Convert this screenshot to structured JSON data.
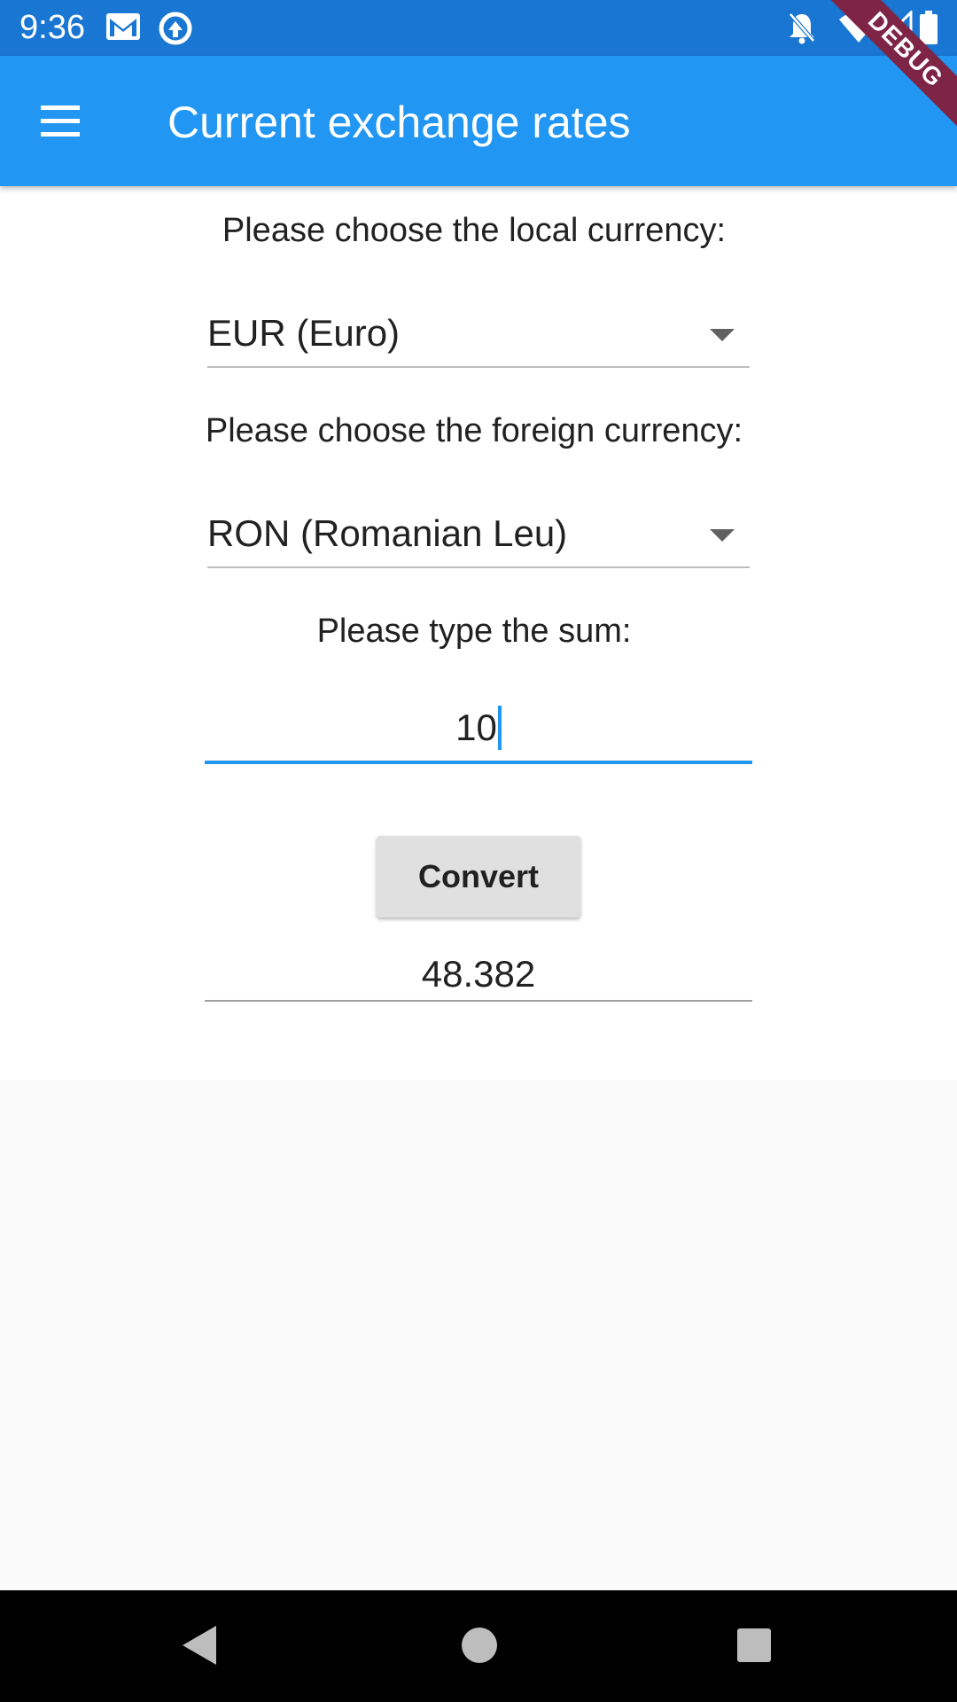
{
  "status_bar": {
    "time": "9:36",
    "icons": [
      "gmail-icon",
      "sync-icon",
      "notifications-off-icon",
      "wifi-icon",
      "signal-icon",
      "battery-icon"
    ]
  },
  "debug_banner": "DEBUG",
  "app_bar": {
    "title": "Current exchange rates",
    "background": "#2196f3"
  },
  "form": {
    "local_currency_label": "Please choose the local currency:",
    "local_currency_value": "EUR (Euro)",
    "foreign_currency_label": "Please choose the foreign currency:",
    "foreign_currency_value": "RON (Romanian Leu)",
    "sum_label": "Please type the sum:",
    "sum_value": "10",
    "convert_label": "Convert",
    "result_value": "48.382"
  },
  "colors": {
    "accent": "#2196f3",
    "status_bar": "#1976d2",
    "button": "#e0e0e0",
    "debug_ribbon": "#7e2545"
  }
}
